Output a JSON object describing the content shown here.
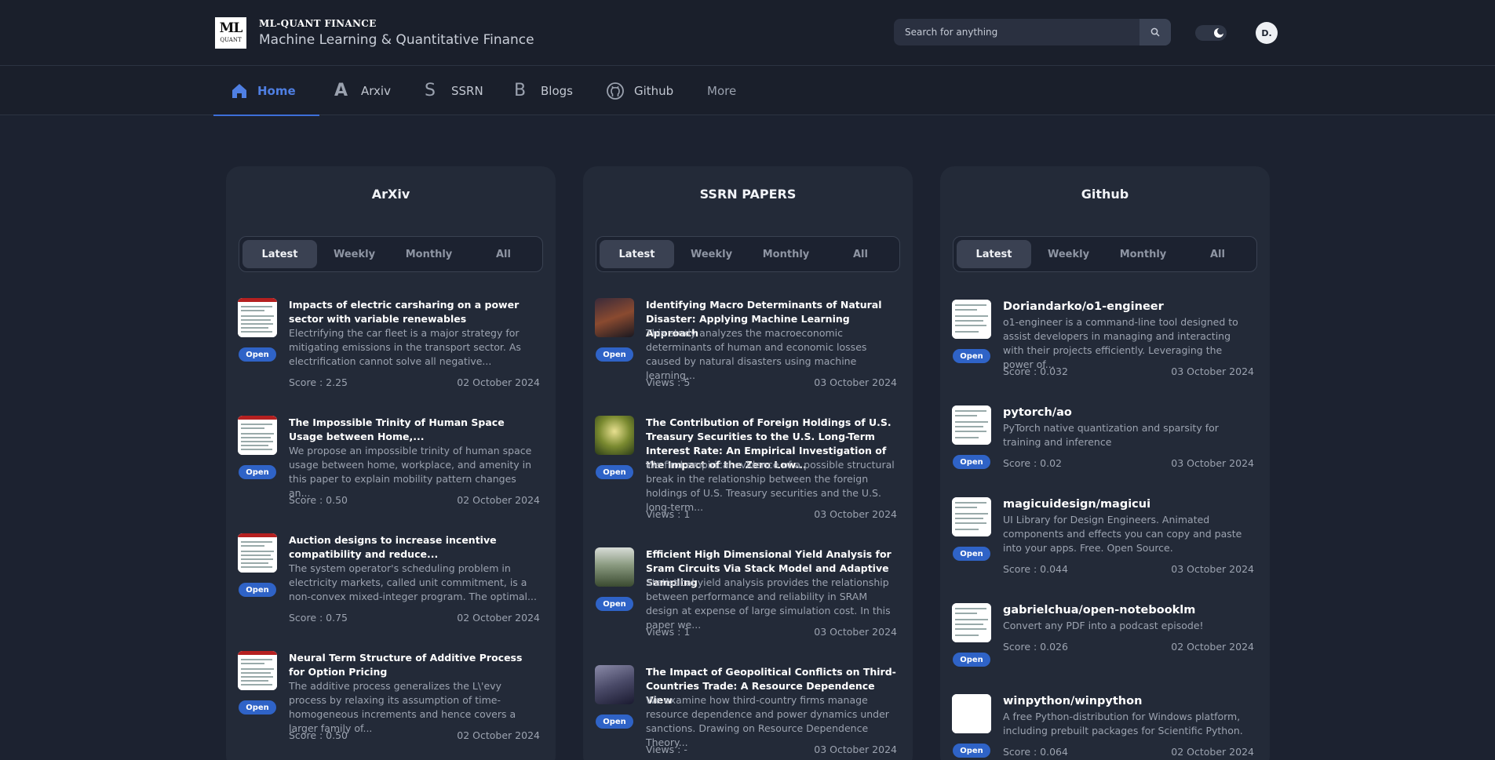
{
  "header": {
    "logo_ml": "ML",
    "logo_quant": "QUANT",
    "brand_small": "ML-QUANT FINANCE",
    "brand_title": "Machine Learning & Quantitative Finance",
    "search_placeholder": "Search for anything",
    "avatar_text": "D."
  },
  "nav": {
    "items": [
      {
        "label": "Home",
        "icon": "home-icon"
      },
      {
        "label": "Arxiv",
        "icon": "A"
      },
      {
        "label": "SSRN",
        "icon": "S"
      },
      {
        "label": "Blogs",
        "icon": "B"
      },
      {
        "label": "Github",
        "icon": "github-icon"
      }
    ],
    "more": "More"
  },
  "tabs": [
    "Latest",
    "Weekly",
    "Monthly",
    "All"
  ],
  "columns": [
    {
      "title": "ArXiv",
      "items": [
        {
          "title": "Impacts of electric carsharing on a power sector with variable renewables",
          "desc": "Electrifying the car fleet is a major strategy for mitigating emissions in the transport sector. As electrification cannot solve all negative...",
          "meta": "Score : 2.25",
          "date": "02 October 2024",
          "open": "Open"
        },
        {
          "title": "The Impossible Trinity of Human Space Usage between Home,...",
          "desc": "We propose an impossible trinity of human space usage between home, workplace, and amenity in this paper to explain mobility pattern changes an...",
          "meta": "Score : 0.50",
          "date": "02 October 2024",
          "open": "Open"
        },
        {
          "title": "Auction designs to increase incentive compatibility and reduce...",
          "desc": "The system operator's scheduling problem in electricity markets, called unit commitment, is a non-convex mixed-integer program. The optimal...",
          "meta": "Score : 0.75",
          "date": "02 October 2024",
          "open": "Open"
        },
        {
          "title": "Neural Term Structure of Additive Process for Option Pricing",
          "desc": "The additive process generalizes the L\\'evy process by relaxing its assumption of time-homogeneous increments and hence covers a larger family of...",
          "meta": "Score : 0.50",
          "date": "02 October 2024",
          "open": "Open"
        }
      ]
    },
    {
      "title": "SSRN PAPERS",
      "items": [
        {
          "title": "Identifying Macro Determinants of Natural Disaster: Applying Machine Learning Approach",
          "desc": "This study analyzes the macroeconomic determinants of human and economic losses caused by natural disasters using machine learning...",
          "meta": "Views : 5",
          "date": "03 October 2024",
          "open": "Open"
        },
        {
          "title": "The Contribution of Foreign Holdings of U.S. Treasury Securities to the U.S. Long-Term Interest Rate: An Empirical Investigation of the Impact of the Zero Low...",
          "desc": "We find empirical evidence of a possible structural break in the relationship between the foreign holdings of U.S. Treasury securities and the U.S. long-term...",
          "meta": "Views : 1",
          "date": "03 October 2024",
          "open": "Open"
        },
        {
          "title": "Efficient High Dimensional Yield Analysis for Sram Circuits Via Stack Model and Adaptive Sampling",
          "desc": "Statistical yield analysis provides the relationship between performance and reliability in SRAM design at expense of large simulation cost. In this paper we...",
          "meta": "Views : 1",
          "date": "03 October 2024",
          "open": "Open"
        },
        {
          "title": "The Impact of Geopolitical Conflicts on Third-Countries Trade: A Resource Dependence View",
          "desc": "We examine how third-country firms manage resource dependence and power dynamics under sanctions. Drawing on Resource Dependence Theory...",
          "meta": "Views : -",
          "date": "03 October 2024",
          "open": "Open"
        }
      ]
    },
    {
      "title": "Github",
      "items": [
        {
          "title": "Doriandarko/o1-engineer",
          "desc": "o1-engineer is a command-line tool designed to assist developers in managing and interacting with their projects efficiently. Leveraging the power of...",
          "meta": "Score : 0.032",
          "date": "03 October 2024",
          "open": "Open"
        },
        {
          "title": "pytorch/ao",
          "desc": "PyTorch native quantization and sparsity for training and inference",
          "meta": "Score : 0.02",
          "date": "03 October 2024",
          "open": "Open"
        },
        {
          "title": "magicuidesign/magicui",
          "desc": "UI Library for Design Engineers. Animated components and effects you can copy and paste into your apps. Free. Open Source.",
          "meta": "Score : 0.044",
          "date": "03 October 2024",
          "open": "Open"
        },
        {
          "title": "gabrielchua/open-notebooklm",
          "desc": "Convert any PDF into a podcast episode!",
          "meta": "Score : 0.026",
          "date": "02 October 2024",
          "open": "Open"
        },
        {
          "title": "winpython/winpython",
          "desc": "A free Python-distribution for Windows platform, including prebuilt packages for Scientific Python.",
          "meta": "Score : 0.064",
          "date": "02 October 2024",
          "open": "Open"
        }
      ]
    }
  ]
}
